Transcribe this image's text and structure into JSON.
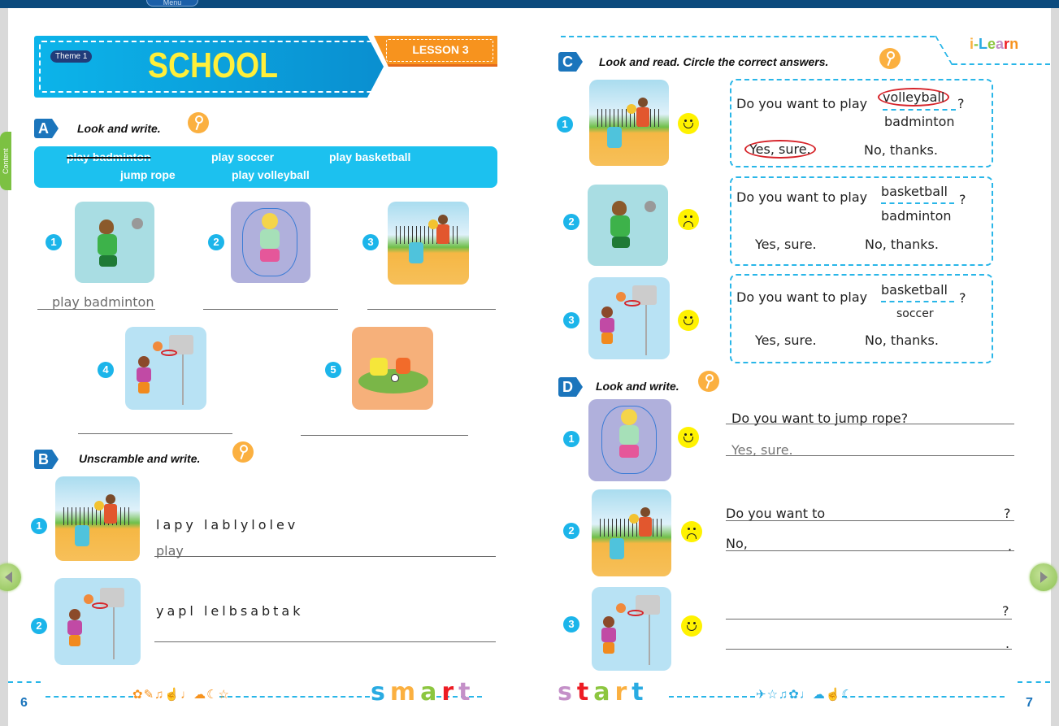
{
  "app": {
    "menu_label": "Menu",
    "content_tab": "Content"
  },
  "navigation": {
    "prev_label": "Previous page",
    "next_label": "Next page"
  },
  "banner": {
    "theme": "Theme 1",
    "title": "SCHOOL",
    "lesson": "LESSON 3"
  },
  "brand": {
    "logo_letters": [
      "i",
      "-",
      "L",
      "e",
      "a",
      "r",
      "n"
    ]
  },
  "sectionA": {
    "letter": "A",
    "title": "Look and write.",
    "wordbank": [
      {
        "text": "play badminton",
        "crossed": true
      },
      {
        "text": "play soccer",
        "crossed": false
      },
      {
        "text": "play basketball",
        "crossed": false
      },
      {
        "text": "jump rope",
        "crossed": false
      },
      {
        "text": "play volleyball",
        "crossed": false
      }
    ],
    "items": [
      {
        "num": "1",
        "picture": "boy playing badminton",
        "answer": "play badminton"
      },
      {
        "num": "2",
        "picture": "girl jumping rope",
        "answer": ""
      },
      {
        "num": "3",
        "picture": "kids playing volleyball",
        "answer": ""
      },
      {
        "num": "4",
        "picture": "girl playing basketball",
        "answer": ""
      },
      {
        "num": "5",
        "picture": "boys playing soccer",
        "answer": ""
      }
    ]
  },
  "sectionB": {
    "letter": "B",
    "title": "Unscramble and write.",
    "items": [
      {
        "num": "1",
        "picture": "kids playing volleyball",
        "scrambled": "lapy  lablylolev",
        "answer": "play"
      },
      {
        "num": "2",
        "picture": "girl playing basketball",
        "scrambled": "yapl  lelbsabtak",
        "answer": ""
      }
    ]
  },
  "sectionC": {
    "letter": "C",
    "title": "Look and read. Circle the correct answers.",
    "items": [
      {
        "num": "1",
        "picture": "kids playing volleyball",
        "face": "happy",
        "question": "Do you want to play",
        "opt1": "volleyball",
        "opt2": "badminton",
        "qmark": "?",
        "yes": "Yes, sure.",
        "no": "No, thanks.",
        "circled_option": "volleyball",
        "circled_reply": "Yes, sure."
      },
      {
        "num": "2",
        "picture": "boy playing badminton",
        "face": "sad",
        "question": "Do you want to play",
        "opt1": "basketball",
        "opt2": "badminton",
        "qmark": "?",
        "yes": "Yes, sure.",
        "no": "No, thanks."
      },
      {
        "num": "3",
        "picture": "girl playing basketball",
        "face": "happy",
        "question": "Do you want to play",
        "opt1": "basketball",
        "opt2": "soccer",
        "qmark": "?",
        "yes": "Yes, sure.",
        "no": "No, thanks."
      }
    ]
  },
  "sectionD": {
    "letter": "D",
    "title": "Look and write.",
    "items": [
      {
        "num": "1",
        "picture": "girl jumping rope",
        "face": "happy",
        "line1": "Do you want to jump rope?",
        "line1_end": "",
        "line2": "Yes, sure.",
        "line2_end": ""
      },
      {
        "num": "2",
        "picture": "kids playing volleyball",
        "face": "sad",
        "line1": "Do you want to",
        "line1_end": "?",
        "line2": "No,",
        "line2_end": "."
      },
      {
        "num": "3",
        "picture": "girl playing basketball",
        "face": "happy",
        "line1": "",
        "line1_end": "?",
        "line2": "",
        "line2_end": "."
      }
    ]
  },
  "footer": {
    "page_left": "6",
    "page_right": "7",
    "smart": [
      "s",
      "m",
      "a",
      "r",
      "t"
    ],
    "start": [
      "s",
      "t",
      "a",
      "r",
      "t"
    ],
    "smart_colors": [
      "#29abe2",
      "#fbb040",
      "#8cc63f",
      "#ed1c24",
      "#c490c8"
    ],
    "start_colors": [
      "#c490c8",
      "#ed1c24",
      "#8cc63f",
      "#fbb040",
      "#29abe2"
    ],
    "doodles_left": "✿✎♫☝♩☁☾☆",
    "doodles_right": "✈☆♫✿♩☁☝☾"
  },
  "colors": {
    "accent_blue": "#1b75bc",
    "cyan": "#1cc1ef",
    "orange": "#f7931e",
    "key": "#fbb040",
    "circle_red": "#d6242a"
  }
}
